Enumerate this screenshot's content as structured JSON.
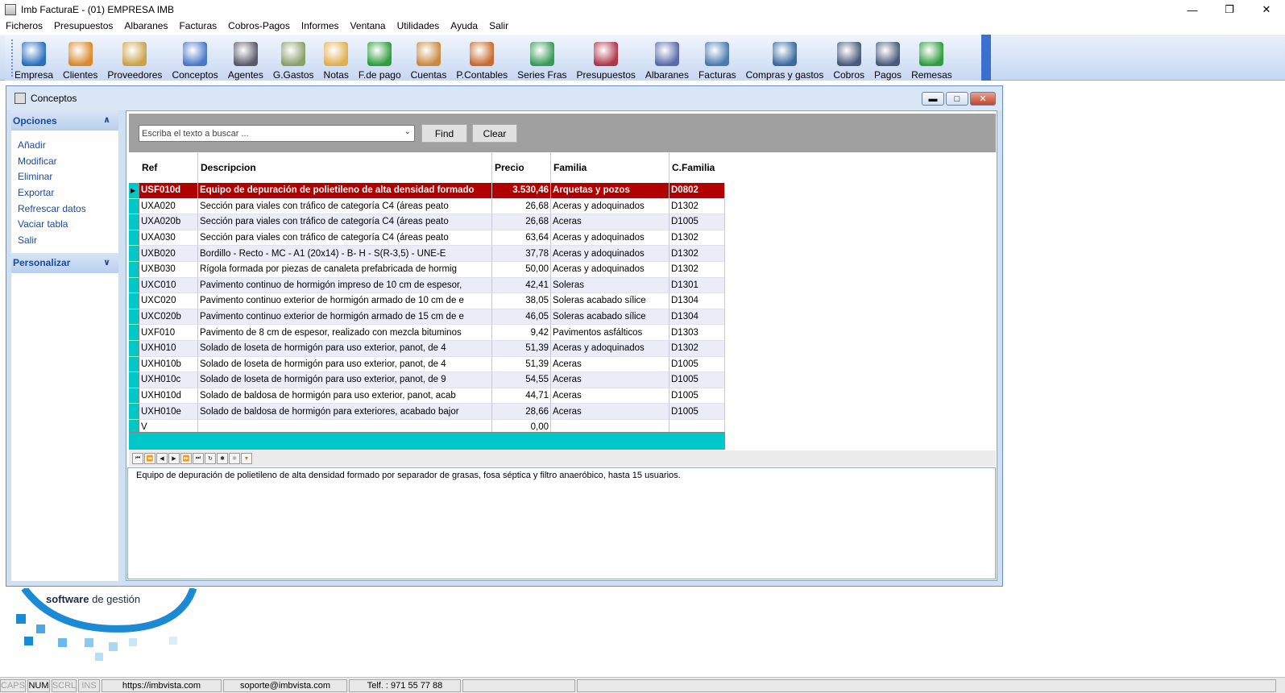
{
  "window": {
    "title": "Imb FacturaE - (01)  EMPRESA IMB",
    "controls": [
      "minimize",
      "restore",
      "close"
    ]
  },
  "menu": [
    "Ficheros",
    "Presupuestos",
    "Albaranes",
    "Facturas",
    "Cobros-Pagos",
    "Informes",
    "Ventana",
    "Utilidades",
    "Ayuda",
    "Salir"
  ],
  "toolbar": [
    {
      "label": "Empresa",
      "icon": "monitor-icon",
      "color": "#2a6fbf"
    },
    {
      "label": "Clientes",
      "icon": "people-icon",
      "color": "#d98a2b"
    },
    {
      "label": "Proveedores",
      "icon": "suppliers-icon",
      "color": "#c9a34a"
    },
    {
      "label": "Conceptos",
      "icon": "store-icon",
      "color": "#4a78c9"
    },
    {
      "label": "Agentes",
      "icon": "agents-icon",
      "color": "#5a5a6a"
    },
    {
      "label": "G.Gastos",
      "icon": "expenses-icon",
      "color": "#8aa06a"
    },
    {
      "label": "Notas",
      "icon": "notes-icon",
      "color": "#e0b050"
    },
    {
      "label": "F.de pago",
      "icon": "euro-icon",
      "color": "#2e9e3e"
    },
    {
      "label": "Cuentas",
      "icon": "ledger-icon",
      "color": "#c98a40"
    },
    {
      "label": "P.Contables",
      "icon": "accounting-icon",
      "color": "#c96a30"
    },
    {
      "label": "Series Fras",
      "icon": "invoice-series-icon",
      "color": "#3a9a5a"
    },
    {
      "label": "Presupuestos",
      "icon": "budget-icon",
      "color": "#b0364a"
    },
    {
      "label": "Albaranes",
      "icon": "delivery-note-icon",
      "color": "#5a6aaa"
    },
    {
      "label": "Facturas",
      "icon": "invoice-icon",
      "color": "#4a7ab0"
    },
    {
      "label": "Compras y gastos",
      "icon": "purchases-icon",
      "color": "#3a6aa0"
    },
    {
      "label": "Cobros",
      "icon": "collections-icon",
      "color": "#4a5a7a"
    },
    {
      "label": "Pagos",
      "icon": "payments-icon",
      "color": "#4a5a7a"
    },
    {
      "label": "Remesas",
      "icon": "bank-icon",
      "color": "#2e9e3e"
    }
  ],
  "child_window": {
    "title": "Conceptos"
  },
  "side_panel": {
    "opciones_header": "Opciones",
    "opciones_items": [
      "Añadir",
      "Modificar",
      "Eliminar",
      "Exportar",
      "Refrescar datos",
      "Vaciar tabla",
      "Salir"
    ],
    "personalizar_header": "Personalizar"
  },
  "search": {
    "placeholder": "Escriba el texto a buscar ...",
    "find_label": "Find",
    "clear_label": "Clear"
  },
  "grid": {
    "columns": [
      "Ref",
      "Descripcion",
      "Precio",
      "Familia",
      "C.Familia"
    ],
    "rows": [
      [
        "USF010d",
        "Equipo de depuración de polietileno de alta densidad formado",
        "3.530,46",
        "Arquetas y pozos",
        "D0802"
      ],
      [
        "UXA020",
        "Sección para viales con tráfico de categoría C4 (áreas peato",
        "26,68",
        "Aceras y adoquinados",
        "D1302"
      ],
      [
        "UXA020b",
        "Sección para viales con tráfico de categoría C4 (áreas peato",
        "26,68",
        "Aceras",
        "D1005"
      ],
      [
        "UXA030",
        "Sección para viales con tráfico de categoría C4 (áreas peato",
        "63,64",
        "Aceras y adoquinados",
        "D1302"
      ],
      [
        "UXB020",
        "Bordillo - Recto - MC - A1 (20x14) - B- H - S(R-3,5) - UNE-E",
        "37,78",
        "Aceras y adoquinados",
        "D1302"
      ],
      [
        "UXB030",
        "Rígola formada por piezas de canaleta prefabricada de hormig",
        "50,00",
        "Aceras y adoquinados",
        "D1302"
      ],
      [
        "UXC010",
        "Pavimento continuo de hormigón impreso de 10 cm de espesor,",
        "42,41",
        "Soleras",
        "D1301"
      ],
      [
        "UXC020",
        "Pavimento continuo exterior de hormigón armado de 10 cm de e",
        "38,05",
        "Soleras acabado sílice",
        "D1304"
      ],
      [
        "UXC020b",
        "Pavimento continuo exterior de hormigón armado de 15 cm de e",
        "46,05",
        "Soleras acabado sílice",
        "D1304"
      ],
      [
        "UXF010",
        "Pavimento de 8 cm de espesor, realizado con mezcla bituminos",
        "9,42",
        "Pavimentos asfálticos",
        "D1303"
      ],
      [
        "UXH010",
        "Solado de loseta de hormigón para uso exterior, panot, de 4",
        "51,39",
        "Aceras y adoquinados",
        "D1302"
      ],
      [
        "UXH010b",
        "Solado de loseta de hormigón para uso exterior, panot, de 4",
        "51,39",
        "Aceras",
        "D1005"
      ],
      [
        "UXH010c",
        "Solado de loseta de hormigón para uso exterior, panot, de 9",
        "54,55",
        "Aceras",
        "D1005"
      ],
      [
        "UXH010d",
        "Solado de baldosa de hormigón para uso exterior, panot, acab",
        "44,71",
        "Aceras",
        "D1005"
      ],
      [
        "UXH010e",
        "Solado de baldosa de hormigón para exteriores, acabado bajor",
        "28,66",
        "Aceras",
        "D1005"
      ],
      [
        "V",
        "",
        "0,00",
        "",
        ""
      ]
    ]
  },
  "memo": {
    "text": "Equipo de depuración de polietileno de alta densidad formado por separador de grasas, fosa séptica y filtro anaeróbico, hasta 15 usuarios."
  },
  "logo": {
    "brand_bold": "software",
    "brand_rest": "de gestión"
  },
  "statusbar": {
    "caps": "CAPS",
    "num": "NUM",
    "scrl": "SCRL",
    "ins": "INS",
    "url": "https://imbvista.com",
    "email": "soporte@imbvista.com",
    "phone": "Telf. : 971 55 77 88"
  }
}
